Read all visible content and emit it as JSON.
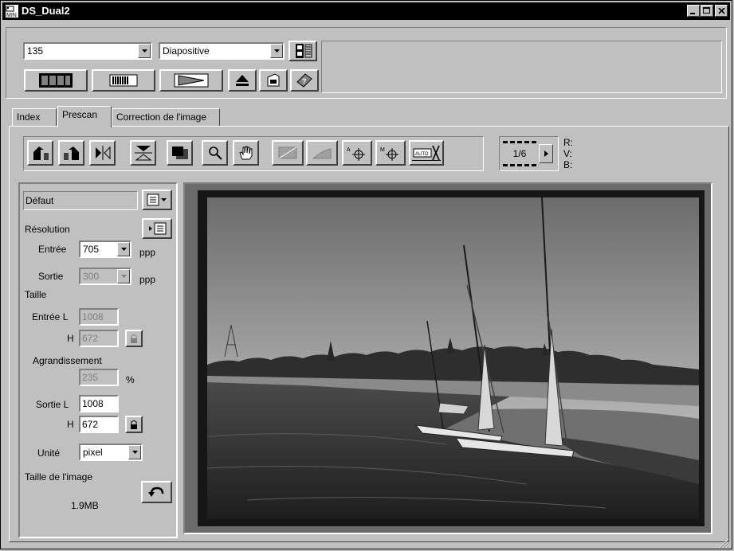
{
  "window": {
    "title": "DS_Dual2"
  },
  "top": {
    "film_format": "135",
    "film_type": "Diapositive"
  },
  "tabs": [
    {
      "label": "Index",
      "active": false
    },
    {
      "label": "Prescan",
      "active": true
    },
    {
      "label": "Correction de l'image",
      "active": false
    }
  ],
  "frame_counter": "1/6",
  "rgb": {
    "r": "R:",
    "v": "V:",
    "b": "B:"
  },
  "settings": {
    "preset": "Défaut",
    "resolution_label": "Résolution",
    "input_label": "Entrée",
    "input_value": "705",
    "input_unit": "ppp",
    "output_label": "Sortie",
    "output_value": "300",
    "output_unit": "ppp",
    "size_label": "Taille",
    "input_w_label": "Entrée L",
    "input_w_value": "1008",
    "input_h_label": "H",
    "input_h_value": "672",
    "magnification_label": "Agrandissement",
    "magnification_value": "235",
    "magnification_unit": "%",
    "output_w_label": "Sortie L",
    "output_w_value": "1008",
    "output_h_label": "H",
    "output_h_value": "672",
    "unit_label": "Unité",
    "unit_value": "pixel",
    "image_size_label": "Taille de l'image",
    "image_size_value": "1.9MB"
  },
  "colors": {
    "titlebar": "#000000",
    "face": "#c0c0c0",
    "preview_border": "#6b6b6b"
  }
}
